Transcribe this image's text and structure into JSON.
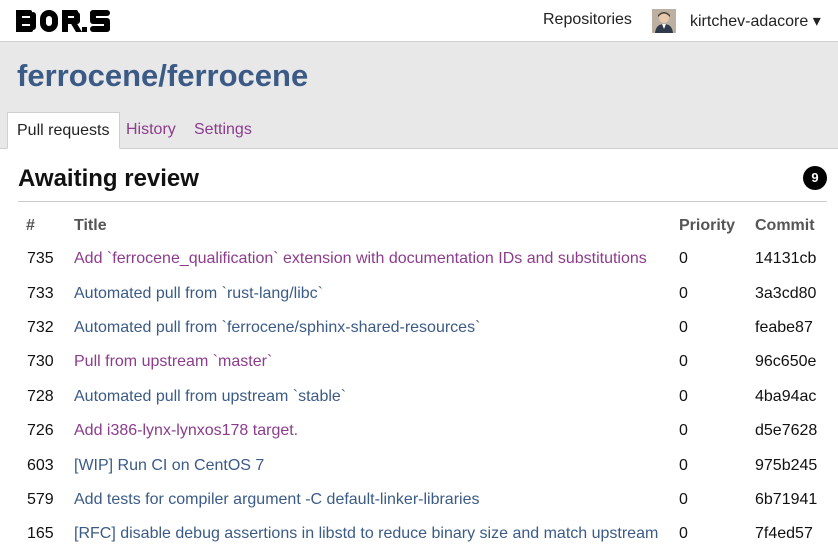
{
  "topbar": {
    "logo_alt": "BORS",
    "repositories_label": "Repositories",
    "user_label": "kirtchev-adacore ▾"
  },
  "header": {
    "repo_title": "ferrocene/ferrocene",
    "tabs": [
      {
        "label": "Pull requests",
        "active": true
      },
      {
        "label": "History",
        "active": false
      },
      {
        "label": "Settings",
        "active": false
      }
    ]
  },
  "section": {
    "title": "Awaiting review",
    "count": "9"
  },
  "table": {
    "headers": {
      "num": "#",
      "title": "Title",
      "priority": "Priority",
      "commit": "Commit"
    },
    "rows": [
      {
        "num": "735",
        "title": "Add `ferrocene_qualification` extension with documentation IDs and substitutions",
        "priority": "0",
        "commit": "14131cb",
        "visited": true
      },
      {
        "num": "733",
        "title": "Automated pull from `rust-lang/libc`",
        "priority": "0",
        "commit": "3a3cd80",
        "visited": false
      },
      {
        "num": "732",
        "title": "Automated pull from `ferrocene/sphinx-shared-resources`",
        "priority": "0",
        "commit": "feabe87",
        "visited": false
      },
      {
        "num": "730",
        "title": "Pull from upstream `master`",
        "priority": "0",
        "commit": "96c650e",
        "visited": true
      },
      {
        "num": "728",
        "title": "Automated pull from upstream `stable`",
        "priority": "0",
        "commit": "4ba94ac",
        "visited": false
      },
      {
        "num": "726",
        "title": "Add i386-lynx-lynxos178 target.",
        "priority": "0",
        "commit": "d5e7628",
        "visited": true
      },
      {
        "num": "603",
        "title": "[WIP] Run CI on CentOS 7",
        "priority": "0",
        "commit": "975b245",
        "visited": false
      },
      {
        "num": "579",
        "title": "Add tests for compiler argument -C default-linker-libraries",
        "priority": "0",
        "commit": "6b71941",
        "visited": false
      },
      {
        "num": "165",
        "title": "[RFC] disable debug assertions in libstd to reduce binary size and match upstream",
        "priority": "0",
        "commit": "7f4ed57",
        "visited": false
      }
    ]
  },
  "colors": {
    "link": "#3b5b86",
    "visited_link": "#8c3c8c",
    "header_bg": "#e8e8e8"
  }
}
